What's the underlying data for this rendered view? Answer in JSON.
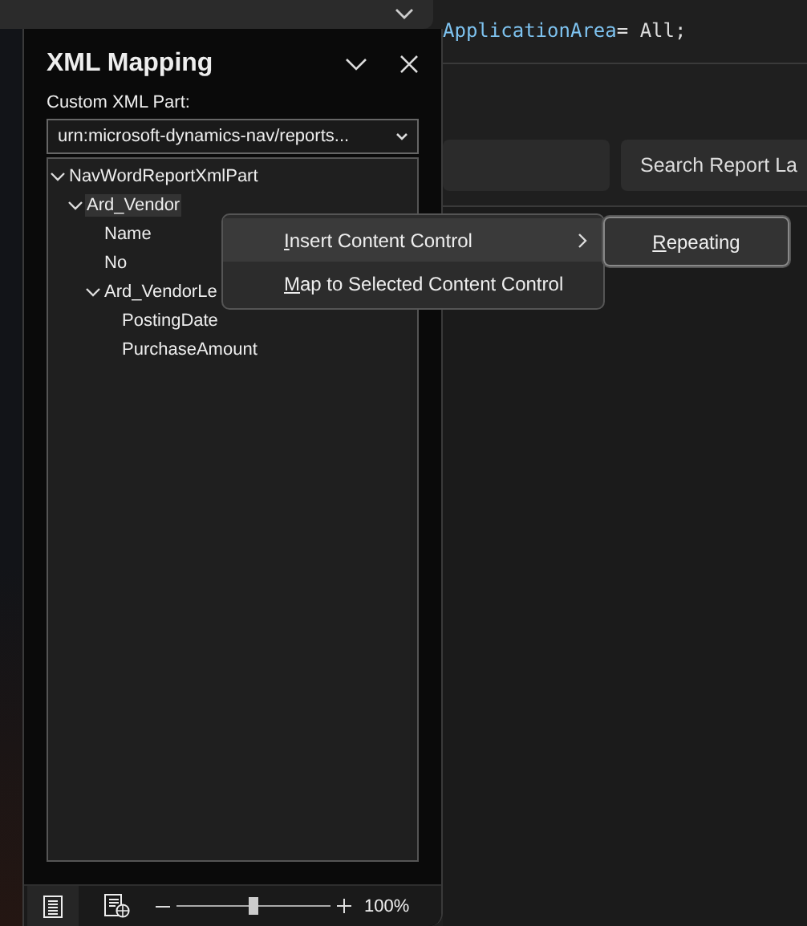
{
  "code_lines": [
    {
      "tokens": [
        {
          "text": "ApplicationArea",
          "kind": "property"
        },
        {
          "text": "= All;",
          "kind": "plain"
        }
      ]
    }
  ],
  "search_button": "Search Report La",
  "panel": {
    "title": "XML Mapping",
    "part_label": "Custom XML Part:",
    "part_value": "urn:microsoft-dynamics-nav/reports...",
    "tree": [
      {
        "label": "NavWordReportXmlPart",
        "expanded": true,
        "selected": false,
        "children": [
          {
            "label": "Ard_Vendor",
            "expanded": true,
            "selected": true,
            "children": [
              {
                "label": "Name",
                "selected": false
              },
              {
                "label": "No",
                "selected": false
              },
              {
                "label": "Ard_VendorLe",
                "expanded": true,
                "selected": false,
                "children": [
                  {
                    "label": "PostingDate",
                    "selected": false
                  },
                  {
                    "label": "PurchaseAmount",
                    "selected": false
                  }
                ]
              }
            ]
          }
        ]
      }
    ]
  },
  "context_menu": [
    {
      "label": "Insert Content Control",
      "selected": true,
      "submenu": true
    },
    {
      "label": "Map to Selected Content Control",
      "selected": false,
      "submenu": false
    }
  ],
  "submenu": [
    {
      "label": "Repeating",
      "selected": true
    }
  ],
  "status_bar": {
    "zoom": {
      "level": 0.5
    },
    "zoom_text": "100%"
  }
}
